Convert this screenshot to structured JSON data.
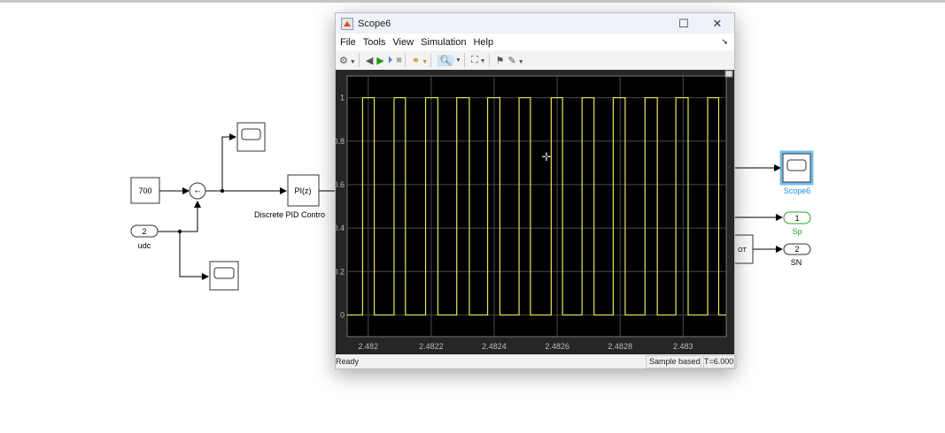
{
  "diagram": {
    "constant_value": "700",
    "sum_signs": "+-",
    "pid_block": "PI(z)",
    "pid_label": "Discrete PID Contro",
    "inport_number": "2",
    "inport_label": "udc",
    "scope6_label": "Scope6",
    "outport1_number": "1",
    "outport1_label": "Sp",
    "outport2_number": "2",
    "outport2_label": "SN",
    "partial_block_text": "OT",
    "selected_color": "#1e90e0",
    "outport1_color": "#2ca02c"
  },
  "scope_window": {
    "title": "Scope6",
    "menu": [
      "File",
      "Tools",
      "View",
      "Simulation",
      "Help"
    ],
    "toolbar_icons": [
      "settings-icon",
      "step-back-icon",
      "run-icon",
      "step-forward-icon",
      "stop-icon",
      "signal-highlight-icon",
      "zoom-in-icon",
      "autoscale-icon",
      "cursor-measure-icon",
      "style-icon"
    ],
    "status": "Ready",
    "sample_mode": "Sample based",
    "time": "T=6.000"
  },
  "chart_data": {
    "type": "line",
    "line_color": "#e6e65a",
    "background": "#000000",
    "grid": true,
    "xlim": [
      2.481933,
      2.483137
    ],
    "ylim": [
      -0.1,
      1.1
    ],
    "x_ticks": [
      "2.482",
      "2.4822",
      "2.4824",
      "2.4826",
      "2.4828",
      "2.483"
    ],
    "x_tick_values": [
      2.482,
      2.4822,
      2.4824,
      2.4826,
      2.4828,
      2.483
    ],
    "y_ticks": [
      "0",
      "0.2",
      "0.4",
      "0.6",
      "0.8",
      "1"
    ],
    "y_tick_values": [
      0,
      0.2,
      0.4,
      0.6,
      0.8,
      1
    ],
    "low": 0,
    "high": 1,
    "pulses": [
      [
        2.481982,
        2.482019
      ],
      [
        2.482082,
        2.482118
      ],
      [
        2.482182,
        2.482221
      ],
      [
        2.482281,
        2.482321
      ],
      [
        2.482379,
        2.482418
      ],
      [
        2.482479,
        2.482515
      ],
      [
        2.482581,
        2.482617
      ],
      [
        2.482679,
        2.482717
      ],
      [
        2.482778,
        2.482816
      ],
      [
        2.482879,
        2.482918
      ],
      [
        2.482977,
        2.483016
      ],
      [
        2.483078,
        2.483113
      ]
    ]
  }
}
